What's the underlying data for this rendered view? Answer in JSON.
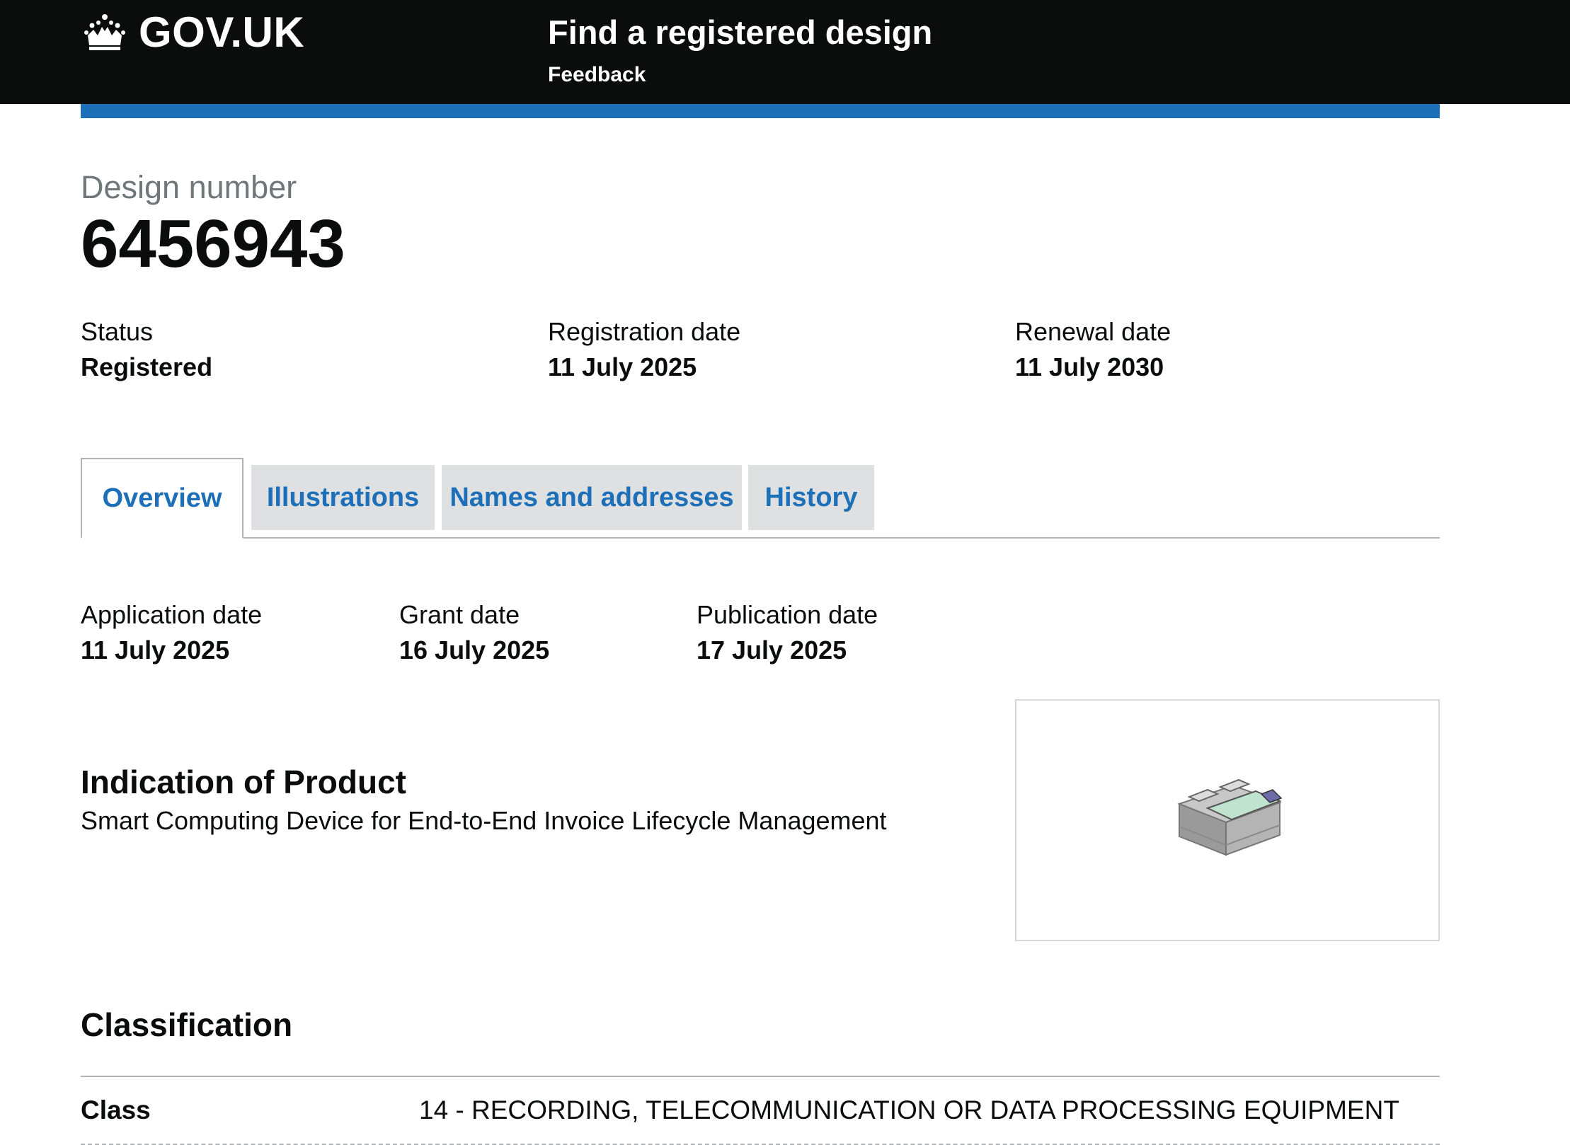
{
  "header": {
    "logo_text": "GOV.UK",
    "service_name": "Find a registered design",
    "feedback_label": "Feedback"
  },
  "design": {
    "caption": "Design number",
    "number": "6456943"
  },
  "summary": {
    "status_label": "Status",
    "status_value": "Registered",
    "registration_label": "Registration date",
    "registration_value": "11 July 2025",
    "renewal_label": "Renewal date",
    "renewal_value": "11 July 2030"
  },
  "tabs": [
    {
      "label": "Overview",
      "active": true
    },
    {
      "label": "Illustrations",
      "active": false
    },
    {
      "label": "Names and addresses",
      "active": false
    },
    {
      "label": "History",
      "active": false
    }
  ],
  "overview": {
    "application_label": "Application date",
    "application_value": "11 July 2025",
    "grant_label": "Grant date",
    "grant_value": "16 July 2025",
    "publication_label": "Publication date",
    "publication_value": "17 July 2025",
    "product_heading": "Indication of Product",
    "product_text": "Smart Computing Device for End-to-End Invoice Lifecycle Management",
    "classification_heading": "Classification",
    "class_label": "Class",
    "class_value": "14 - RECORDING, TELECOMMUNICATION OR DATA PROCESSING EQUIPMENT"
  },
  "colors": {
    "header_bg": "#0b0c0c",
    "brand_blue": "#1d70b8",
    "tab_bg": "#dee0e2",
    "border": "#b1b4b6"
  }
}
